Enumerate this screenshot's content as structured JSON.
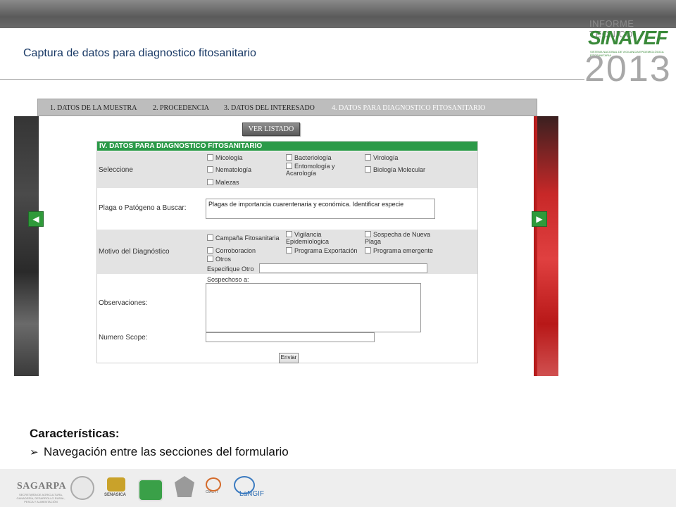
{
  "header": {
    "title": "Captura de datos para diagnostico fitosanitario",
    "brand_top": "INFORME TECNICO",
    "brand_name": "SINAVEF",
    "brand_sub": "SISTEMA NACIONAL DE VIGILANCIA EPIDEMIOLÓGICA FITOSANITARIA",
    "brand_year": "2013"
  },
  "tabs": [
    {
      "label": "1. DATOS DE LA MUESTRA"
    },
    {
      "label": "2. PROCEDENCIA"
    },
    {
      "label": "3. DATOS DEL INTERESADO"
    },
    {
      "label": "4. DATOS PARA DIAGNOSTICO FITOSANITARIO"
    }
  ],
  "ver_listado": "VER LISTADO",
  "form": {
    "heading": "IV. DATOS PARA DIAGNOSTICO FITOSANITARIO",
    "seleccione_label": "Seleccione",
    "seleccione_options": [
      "Micología",
      "Bacteriología",
      "Virología",
      "Nematología",
      "Entomología y Acarología",
      "Biología Molecular",
      "Malezas"
    ],
    "plaga_label": "Plaga o Patógeno a Buscar:",
    "plaga_value": "Plagas de importancia cuarentenaria y económica. Identificar especie",
    "motivo_label": "Motivo del Diagnóstico",
    "motivo_options": [
      "Campaña Fitosanitaria",
      "Vigilancia Epidemiologica",
      "Sospecha de Nueva Plaga",
      "Corroboracion",
      "Programa Exportación",
      "Programa emergente",
      "Otros"
    ],
    "especifique_label": "Especifique Otro",
    "sospechoso_label": "Sospechoso a:",
    "observaciones_label": "Observaciones:",
    "numero_scope_label": "Numero Scope:",
    "enviar_label": "Enviar"
  },
  "features": {
    "title": "Características:",
    "items": [
      "Navegación entre las secciones del formulario"
    ]
  },
  "footer": {
    "sagarpa": "SAGARPA",
    "sagarpa_sub": "SECRETARÍA DE AGRICULTURA, GANADERÍA, DESARROLLO RURAL, PESCA Y ALIMENTACIÓN",
    "senasica": "SENASICA",
    "cacyt": "CIACYT",
    "langif": "LaNGIF"
  },
  "colors": {
    "form_heading": "#2b9a48",
    "title_text": "#1a3a66",
    "brand_green": "#3a8a3a"
  }
}
